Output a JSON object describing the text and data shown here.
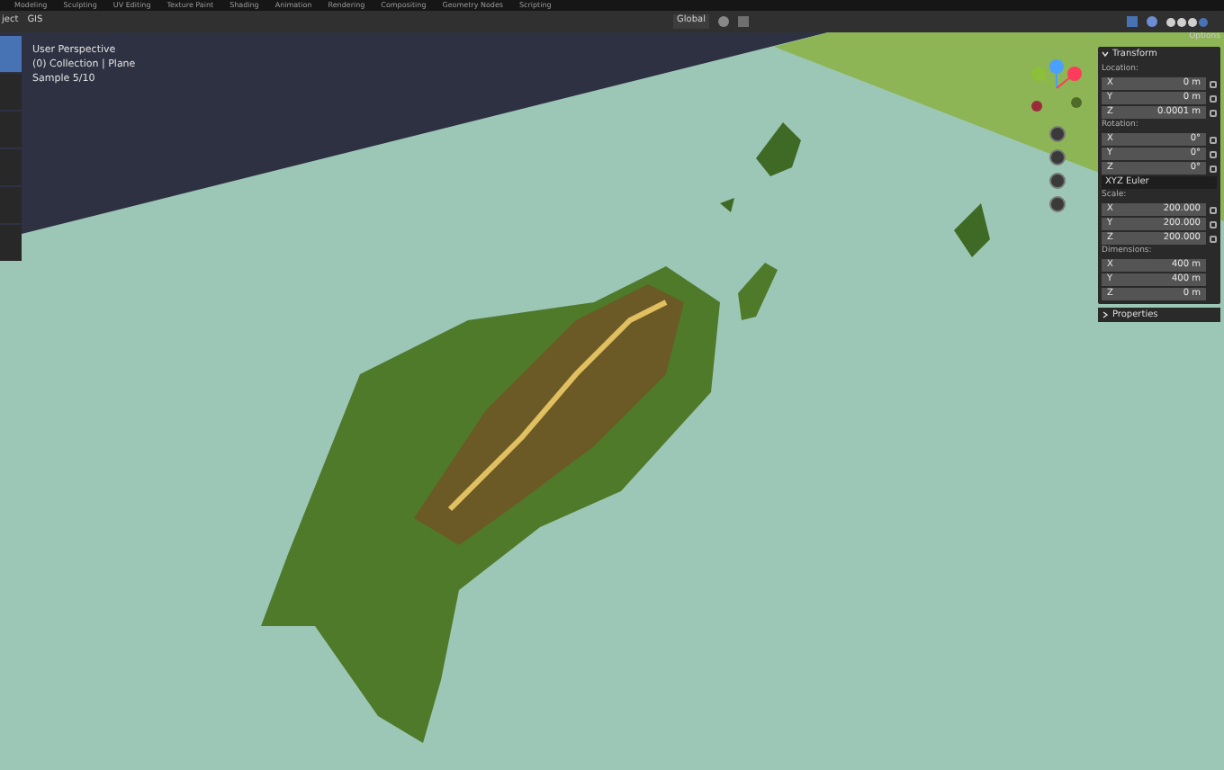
{
  "workspace_tabs": [
    "Modeling",
    "Sculpting",
    "UV Editing",
    "Texture Paint",
    "Shading",
    "Animation",
    "Rendering",
    "Compositing",
    "Geometry Nodes",
    "Scripting"
  ],
  "header": {
    "menus": [
      "ject",
      "GIS"
    ],
    "orientation": "Global",
    "options": "Options"
  },
  "toolbar": [
    {
      "selected": true
    },
    {
      "selected": false
    },
    {
      "selected": false
    },
    {
      "selected": false
    },
    {
      "selected": false
    },
    {
      "selected": false
    }
  ],
  "viewport_info": [
    "User Perspective",
    "(0) Collection | Plane",
    "Sample 5/10"
  ],
  "sidebar": {
    "title": "Transform",
    "expanded": true,
    "groups": [
      {
        "label": "Location:",
        "rows": [
          {
            "axis": "X",
            "value": "0 m"
          },
          {
            "axis": "Y",
            "value": "0 m"
          },
          {
            "axis": "Z",
            "value": "0.0001 m"
          }
        ],
        "locks": true
      },
      {
        "label": "Rotation:",
        "rows": [
          {
            "axis": "X",
            "value": "0°"
          },
          {
            "axis": "Y",
            "value": "0°"
          },
          {
            "axis": "Z",
            "value": "0°"
          }
        ],
        "locks": true,
        "mode": "XYZ Euler"
      },
      {
        "label": "Scale:",
        "rows": [
          {
            "axis": "X",
            "value": "200.000"
          },
          {
            "axis": "Y",
            "value": "200.000"
          },
          {
            "axis": "Z",
            "value": "200.000"
          }
        ],
        "locks": true
      },
      {
        "label": "Dimensions:",
        "rows": [
          {
            "axis": "X",
            "value": "400 m"
          },
          {
            "axis": "Y",
            "value": "400 m"
          },
          {
            "axis": "Z",
            "value": "0 m"
          }
        ],
        "locks": false
      }
    ],
    "properties": {
      "title": "Properties",
      "expanded": false
    }
  }
}
